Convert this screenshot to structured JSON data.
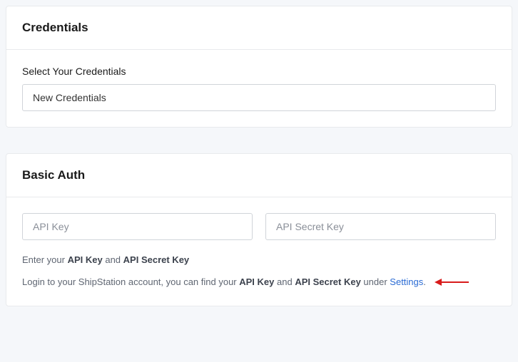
{
  "credentials": {
    "title": "Credentials",
    "select_label": "Select Your Credentials",
    "selected_value": "New Credentials"
  },
  "basic_auth": {
    "title": "Basic Auth",
    "api_key_placeholder": "API Key",
    "api_secret_placeholder": "API Secret Key",
    "helper1_prefix": "Enter your ",
    "helper1_key": "API Key",
    "helper1_mid": " and ",
    "helper1_secret": "API Secret Key",
    "helper2_prefix": "Login to your ShipStation account, you can find your ",
    "helper2_key": "API Key",
    "helper2_mid": " and ",
    "helper2_secret": "API Secret Key",
    "helper2_under": " under ",
    "helper2_link": "Settings",
    "helper2_period": "."
  }
}
